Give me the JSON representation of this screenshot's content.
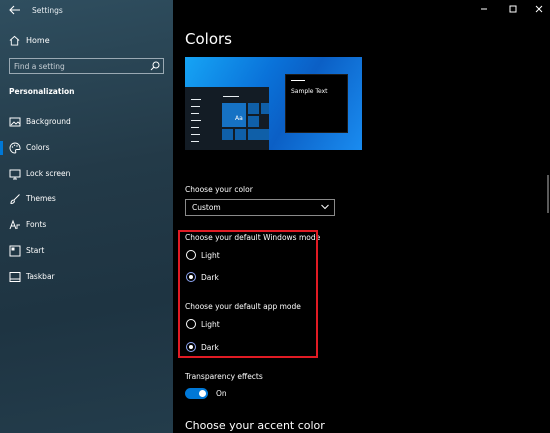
{
  "window": {
    "title": "Settings"
  },
  "sidebar": {
    "home_label": "Home",
    "search": {
      "placeholder": "Find a setting"
    },
    "section_title": "Personalization",
    "items": [
      {
        "label": "Background",
        "icon": "image-icon"
      },
      {
        "label": "Colors",
        "icon": "palette-icon",
        "active": true
      },
      {
        "label": "Lock screen",
        "icon": "monitor-icon"
      },
      {
        "label": "Themes",
        "icon": "brush-icon"
      },
      {
        "label": "Fonts",
        "icon": "font-icon"
      },
      {
        "label": "Start",
        "icon": "start-icon"
      },
      {
        "label": "Taskbar",
        "icon": "taskbar-icon"
      }
    ]
  },
  "main": {
    "title": "Colors",
    "preview": {
      "tile_label": "Aa",
      "sample_text": "Sample Text"
    },
    "choose_color": {
      "label": "Choose your color",
      "value": "Custom"
    },
    "windows_mode": {
      "label": "Choose your default Windows mode",
      "options": [
        "Light",
        "Dark"
      ],
      "selected": "Dark"
    },
    "app_mode": {
      "label": "Choose your default app mode",
      "options": [
        "Light",
        "Dark"
      ],
      "selected": "Dark"
    },
    "transparency": {
      "label": "Transparency effects",
      "state": "On"
    },
    "accent_heading": "Choose your accent color"
  },
  "colors": {
    "accent": "#0078d7",
    "highlight_border": "#e01b24",
    "sidebar_bg": "#233a48",
    "content_bg": "#000000"
  }
}
